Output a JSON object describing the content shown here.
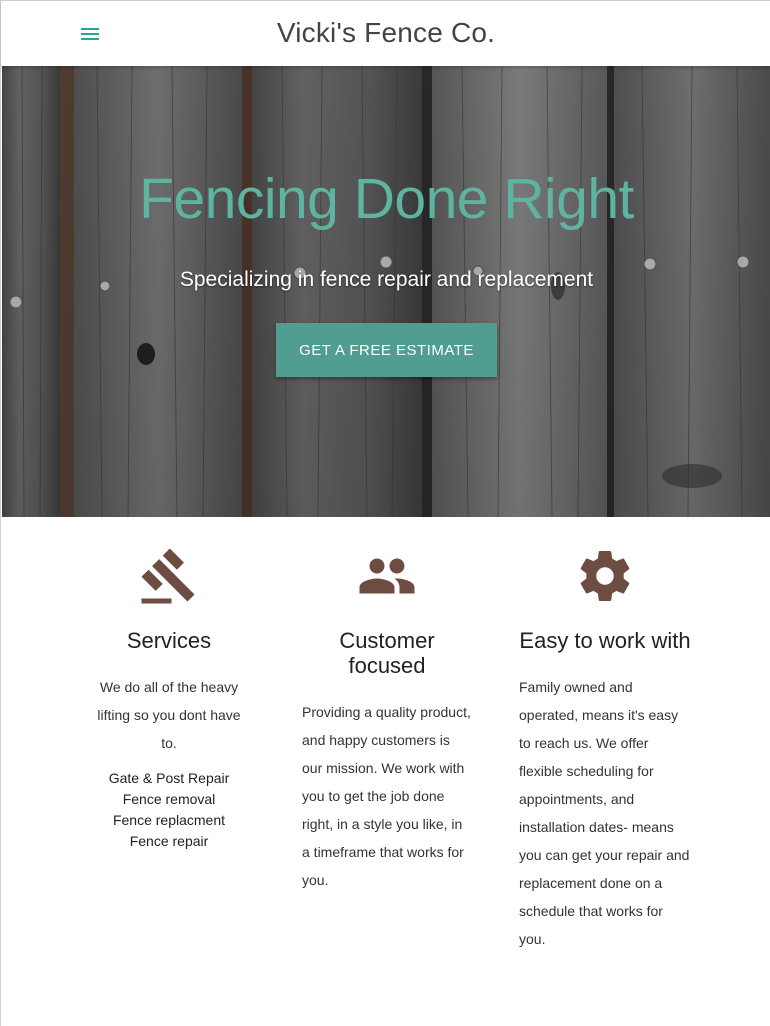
{
  "header": {
    "brand": "Vicki's Fence Co.",
    "menu_icon": "menu-icon"
  },
  "hero": {
    "title": "Fencing Done Right",
    "subtitle": "Specializing in fence repair and replacement",
    "cta_label": "GET A FREE ESTIMATE"
  },
  "features": [
    {
      "icon": "gavel-icon",
      "title": "Services",
      "text": "We do all of the heavy lifting so you dont have to.",
      "list": [
        "Gate & Post Repair",
        "Fence removal",
        "Fence replacment",
        "Fence repair"
      ]
    },
    {
      "icon": "group-icon",
      "title": "Customer focused",
      "text": "Providing a quality product, and happy customers is our mission. We work with you to get the job done right, in a style you like, in a timeframe that works for you."
    },
    {
      "icon": "gear-icon",
      "title": "Easy to work with",
      "text": "Family owned and operated, means it's easy to reach us. We offer flexible scheduling for appointments, and installation dates- means you can get your repair and replacement done on a schedule that works for you."
    }
  ],
  "colors": {
    "accent": "#5eb3a1",
    "button": "#4f9e91",
    "icon": "#6d4c41",
    "nav_icon": "#26a69a"
  }
}
